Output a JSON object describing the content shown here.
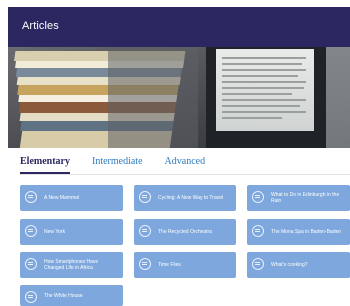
{
  "header": {
    "title": "Articles"
  },
  "tabs": [
    {
      "label": "Elementary",
      "active": true
    },
    {
      "label": "Intermediate",
      "active": false
    },
    {
      "label": "Advanced",
      "active": false
    }
  ],
  "articles": [
    "A New Mammal",
    "Cycling: A New Way to Travel",
    "What to Do in Edinburgh in the Rain",
    "New York",
    "The Recycled Orchestra",
    "The Mona Spa in Baden-Baden",
    "How Smartphones Have Changed Life in Africa",
    "Time Flies",
    "What's cooking?",
    "The White House"
  ],
  "colors": {
    "header": "#2b2861",
    "card": "#7da7dd",
    "tab_link": "#2e7bbf"
  }
}
